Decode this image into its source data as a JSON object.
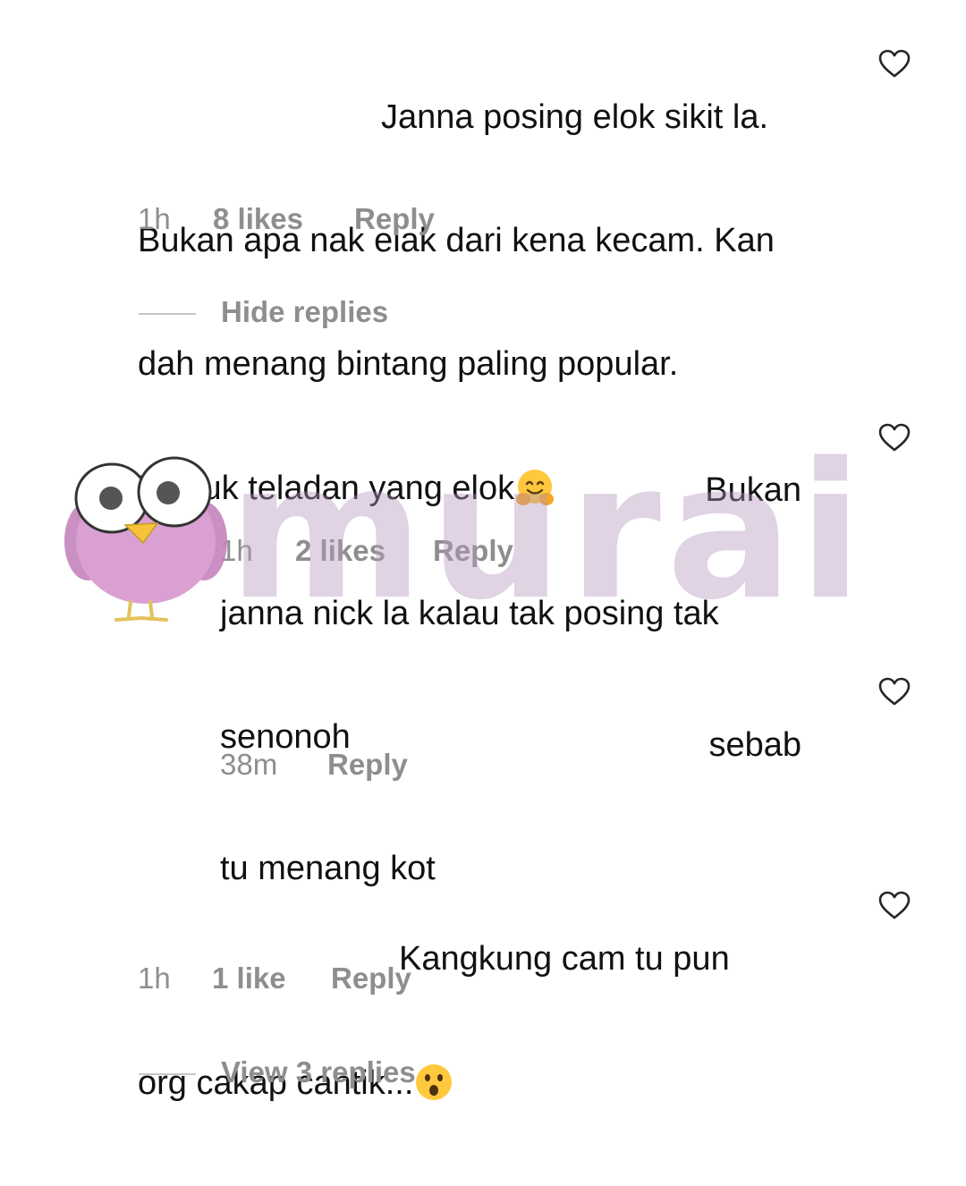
{
  "comments": [
    {
      "lines": [
        "Janna posing elok sikit la.",
        "Bukan apa nak elak dari kena kecam. Kan",
        "dah menang bintang paling popular.",
        "Tunjuk teladan yang elok"
      ],
      "emoji": "hugging-face",
      "time": "1h",
      "likes": "8 likes",
      "reply": "Reply"
    },
    {
      "lines": [
        "Bukan",
        "janna nick la kalau tak posing tak",
        "senonoh"
      ],
      "time": "1h",
      "likes": "2 likes",
      "reply": "Reply"
    },
    {
      "lines": [
        "sebab",
        "tu menang kot"
      ],
      "time": "38m",
      "reply": "Reply"
    },
    {
      "lines": [
        "Kangkung cam tu pun",
        "org cakap cantik..."
      ],
      "emoji": "astonished-face",
      "time": "1h",
      "likes": "1 like",
      "reply": "Reply"
    }
  ],
  "thread_toggles": {
    "hide": "Hide replies",
    "view": "View 3 replies"
  },
  "watermark": {
    "text": "murai"
  },
  "colors": {
    "text": "#111111",
    "meta": "#8e8e8e",
    "watermark": "#b296be",
    "mascot_body": "#d99bd0"
  }
}
